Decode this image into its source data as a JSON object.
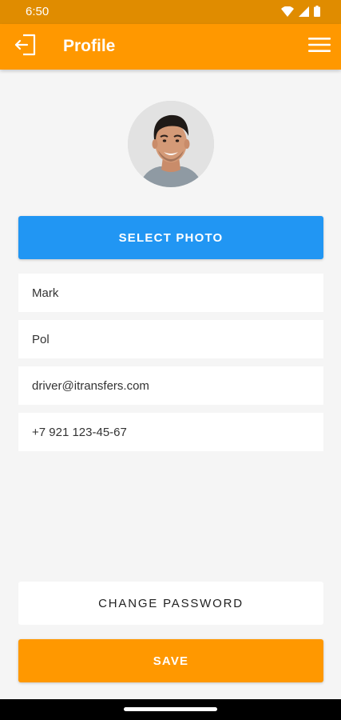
{
  "status_bar": {
    "time": "6:50"
  },
  "app_bar": {
    "title": "Profile",
    "back_icon": "logout-icon",
    "menu_icon": "hamburger-menu-icon",
    "background_color": "#ff9800"
  },
  "profile": {
    "avatar_icon": "profile-photo",
    "select_photo_label": "SELECT PHOTO",
    "fields": {
      "first_name": "Mark",
      "last_name": "Pol",
      "email": "driver@itransfers.com",
      "phone": "+7 921 123-45-67"
    }
  },
  "actions": {
    "change_password_label": "CHANGE PASSWORD",
    "save_label": "SAVE"
  },
  "colors": {
    "accent": "#ff9800",
    "primary_button": "#2196f3",
    "status_bar": "#e08c00"
  }
}
